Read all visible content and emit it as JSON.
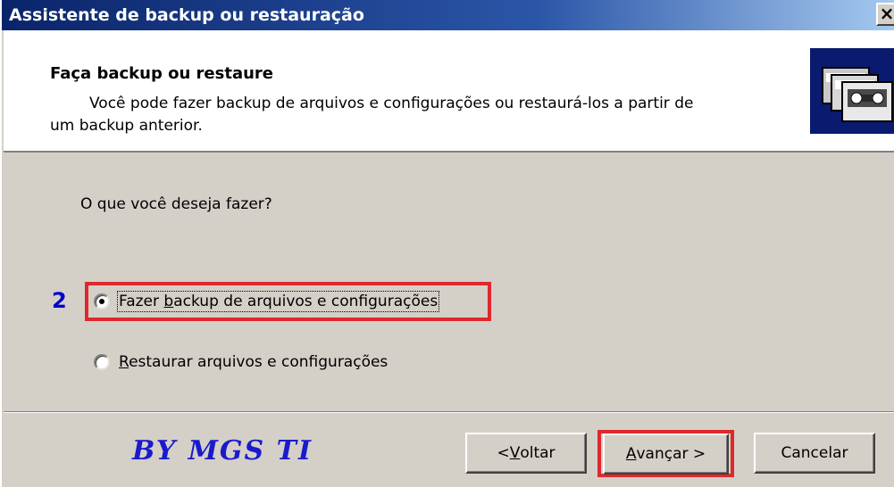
{
  "window": {
    "title": "Assistente de backup ou restauração",
    "close_glyph": "×"
  },
  "header": {
    "title": "Faça backup ou restaure",
    "description_line1": "Você pode fazer backup de arquivos e configurações ou restaurá-los a partir de",
    "description_line2": "um backup anterior.",
    "image_icon": "backup-wizard-icon"
  },
  "body": {
    "question": "O que você deseja fazer?",
    "step_number": "2",
    "options": [
      {
        "underline": "",
        "accel": "b",
        "pre": "Fazer ",
        "post": "ackup de arquivos e configurações",
        "selected": true
      },
      {
        "underline": "",
        "accel": "R",
        "pre": "",
        "post": "estaurar arquivos e configurações",
        "selected": false
      }
    ]
  },
  "footer": {
    "signature": "BY MGS TI",
    "back_pre": "< ",
    "back_accel": "V",
    "back_post": "oltar",
    "next_accel": "A",
    "next_post": "vançar >",
    "cancel_label": "Cancelar"
  },
  "colors": {
    "highlight": "#e0282c",
    "step_number": "#0000cc",
    "signature": "#1a1acc",
    "titlebar_start": "#0a246a",
    "titlebar_end": "#a6caf0"
  }
}
